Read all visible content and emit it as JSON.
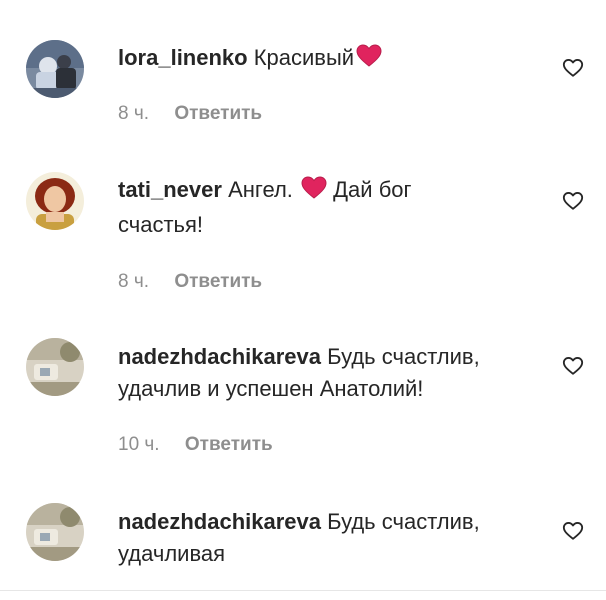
{
  "comments": [
    {
      "username": "lora_linenko",
      "text": "Красивый",
      "time": "8 ч.",
      "reply_label": "Ответить",
      "emoji_after_text": "red-heart"
    },
    {
      "username": "tati_never",
      "text_before": "Ангел.",
      "text_after": "Дай бог счастья!",
      "time": "8 ч.",
      "reply_label": "Ответить",
      "emoji_inline": "red-heart"
    },
    {
      "username": "nadezhdachikareva",
      "text": "Будь счастлив, удачлив и успешен Анатолий!",
      "time": "10 ч.",
      "reply_label": "Ответить"
    },
    {
      "username": "nadezhdachikareva",
      "text": "Будь счастлив, удачливая"
    }
  ],
  "colors": {
    "text": "#262626",
    "meta": "#8e8e8e",
    "heart_emoji": "#e0245e"
  },
  "icons": {
    "like": "heart-outline-icon",
    "emoji": "red-heart-emoji"
  }
}
